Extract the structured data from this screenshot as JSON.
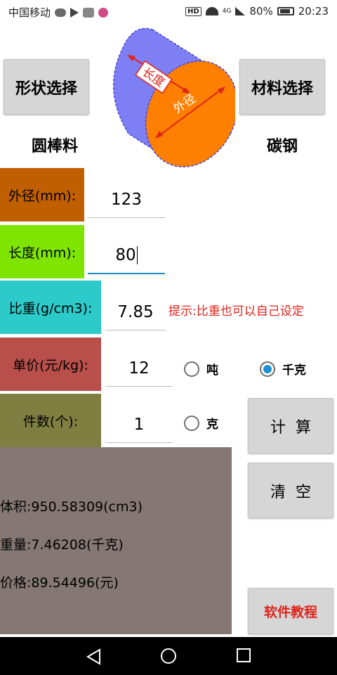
{
  "status_bar": {
    "carrier": "中国移动",
    "hd": "HD",
    "network": "4G",
    "battery": "80%",
    "time": "20:23"
  },
  "top": {
    "shape_button": "形状选择",
    "material_button": "材料选择",
    "shape_name": "圆棒料",
    "material_name": "碳钢",
    "diagram": {
      "length_label": "长度",
      "diameter_label": "外径"
    }
  },
  "fields": [
    {
      "label": "外径(mm):",
      "value": "123",
      "color": "#c05f00"
    },
    {
      "label": "长度(mm):",
      "value": "80",
      "color": "#7fe500"
    },
    {
      "label": "比重(g/cm3):",
      "value": "7.85",
      "color": "#2ccac9"
    },
    {
      "label": "单价(元/kg):",
      "value": "12",
      "color": "#b94f4b"
    },
    {
      "label": "件数(个):",
      "value": "1",
      "color": "#7f7f41"
    }
  ],
  "hint": "提示:比重也可以自己设定",
  "units": {
    "ton": "吨",
    "kg": "千克",
    "gram": "克",
    "selected": "千克"
  },
  "buttons": {
    "calculate": "计算",
    "clear": "清空",
    "tutorial": "软件教程"
  },
  "results": {
    "volume": "体积:950.58309(cm3)",
    "weight": "重量:7.46208(千克)",
    "price": "价格:89.54496(元)"
  },
  "colors": {
    "result_bg": "#857874",
    "accent_blue": "#1e8fd6",
    "hint_red": "#e0231b",
    "cylinder_side": "#7f7ff5",
    "cylinder_face": "#ff8000"
  }
}
